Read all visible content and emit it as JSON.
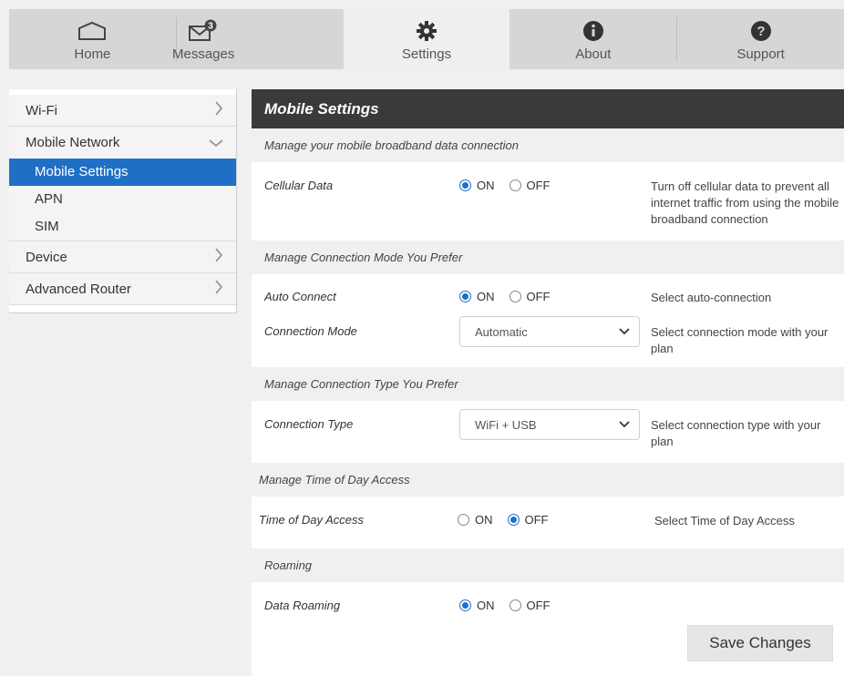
{
  "topbar": {
    "tabs": [
      {
        "label": "Home",
        "icon": "home-icon"
      },
      {
        "label": "Messages",
        "icon": "mail-icon",
        "badge": "3"
      },
      {
        "label": "Settings",
        "icon": "gear-icon"
      },
      {
        "label": "About",
        "icon": "info-icon"
      },
      {
        "label": "Support",
        "icon": "question-icon"
      }
    ],
    "active_tab": "Settings"
  },
  "sidebar": {
    "items": [
      {
        "label": "Wi-Fi"
      },
      {
        "label": "Mobile Network"
      },
      {
        "label": "Device"
      },
      {
        "label": "Advanced Router"
      }
    ],
    "mobile_network_subitems": [
      "Mobile Settings",
      "APN",
      "SIM"
    ],
    "selected": "Mobile Settings"
  },
  "main": {
    "title": "Mobile Settings",
    "sections": {
      "s1": "Manage your mobile broadband data connection",
      "s2": "Manage Connection Mode You Prefer",
      "s3": "Manage Connection Type You Prefer",
      "s4": "Manage Time of Day Access",
      "s5": "Roaming"
    },
    "cellular_data": {
      "label": "Cellular Data",
      "value": "ON",
      "on": "ON",
      "off": "OFF",
      "desc": "Turn off cellular data to prevent all internet traffic from using the mobile broadband connection"
    },
    "auto_connect": {
      "label": "Auto Connect",
      "value": "ON",
      "on": "ON",
      "off": "OFF",
      "desc": "Select auto-connection"
    },
    "connection_mode": {
      "label": "Connection Mode",
      "value": "Automatic",
      "desc": "Select connection mode with your plan"
    },
    "connection_type": {
      "label": "Connection Type",
      "value": "WiFi + USB",
      "desc": "Select connection type with your plan"
    },
    "time_of_day": {
      "label": "Time of Day Access",
      "value": "OFF",
      "on": "ON",
      "off": "OFF",
      "desc": "Select Time of Day Access"
    },
    "data_roaming": {
      "label": "Data Roaming",
      "value": "ON",
      "on": "ON",
      "off": "OFF"
    },
    "save_label": "Save Changes"
  },
  "colors": {
    "accent": "#1f6fc5",
    "header": "#3a3a3a"
  }
}
